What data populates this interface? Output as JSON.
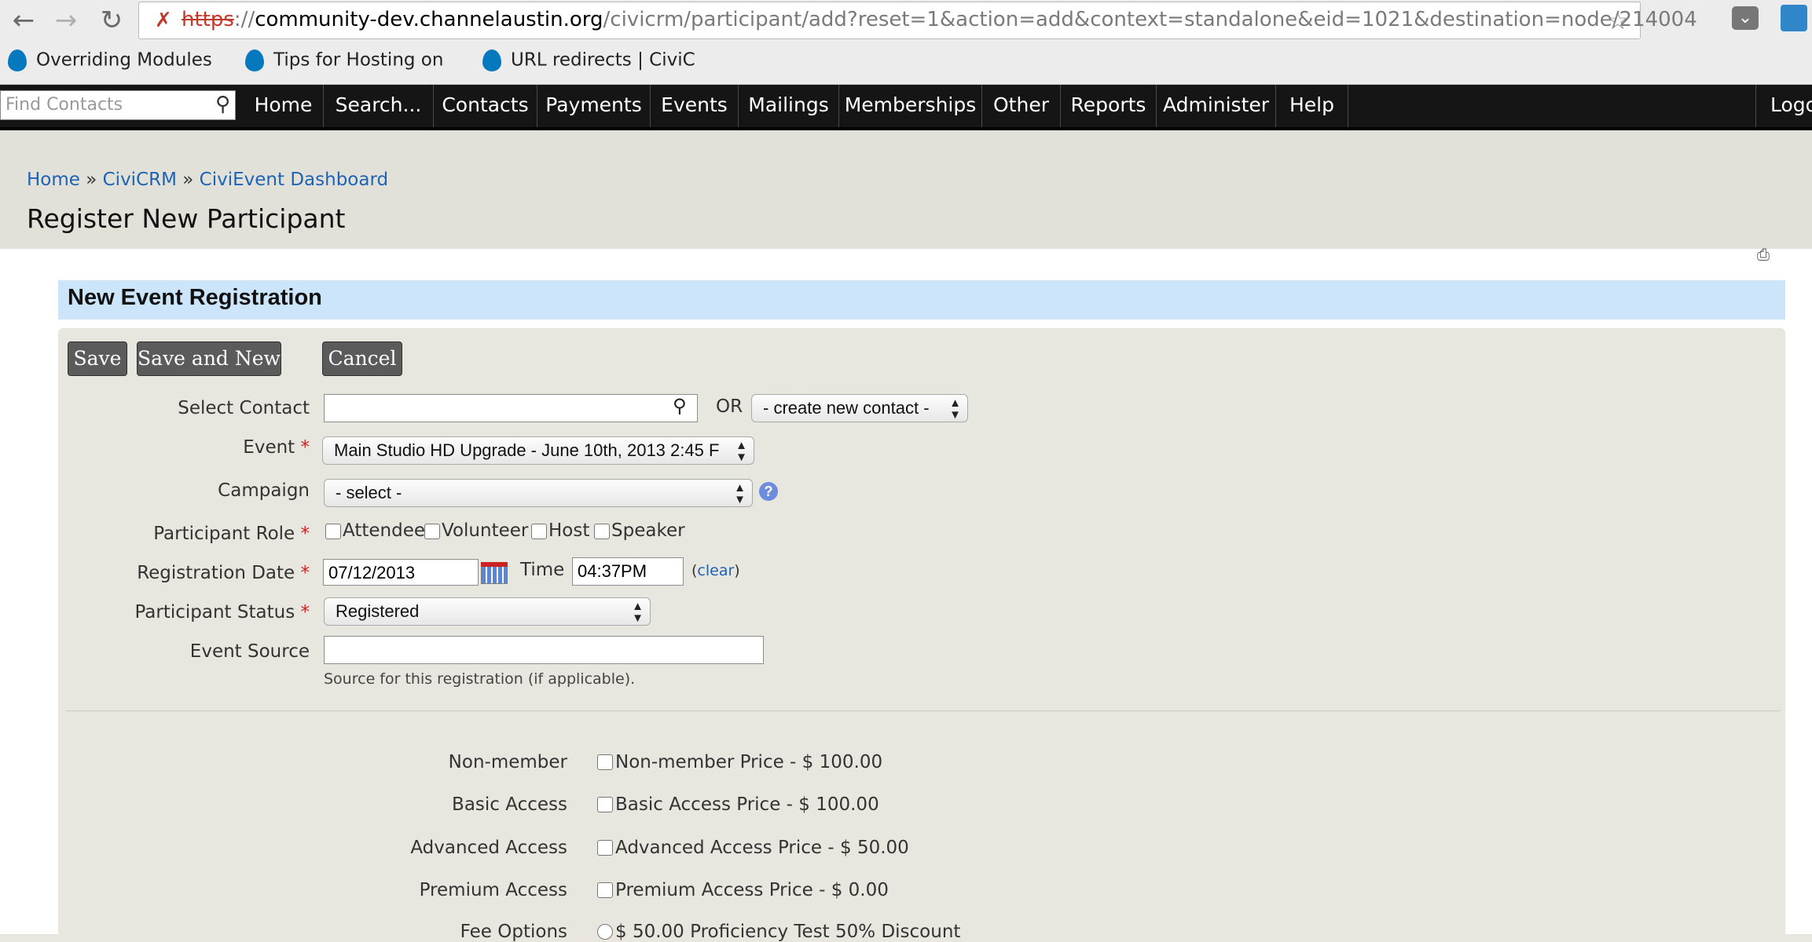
{
  "browser": {
    "url_scheme": "https",
    "url_separator": "://",
    "url_host": "community-dev.channelaustin.org",
    "url_path": "/civicrm/participant/add?reset=1&action=add&context=standalone&eid=1021&destination=node/214004",
    "bookmarks": [
      "Overriding Modules",
      "Tips for Hosting on",
      "URL redirects | CiviC"
    ]
  },
  "menubar": {
    "search_placeholder": "Find Contacts",
    "items": [
      "Home",
      "Search...",
      "Contacts",
      "Payments",
      "Events",
      "Mailings",
      "Memberships",
      "Other",
      "Reports",
      "Administer",
      "Help"
    ],
    "logout": "Logo"
  },
  "breadcrumb": {
    "items": [
      "Home",
      "CiviCRM",
      "CiviEvent Dashboard"
    ],
    "separator": "»"
  },
  "page_title": "Register New Participant",
  "section_title": "New Event Registration",
  "buttons": {
    "save": "Save",
    "save_and_new": "Save and New",
    "cancel": "Cancel"
  },
  "form": {
    "select_contact": {
      "label": "Select Contact",
      "value": "",
      "or_text": "OR",
      "create_new": "- create new contact -"
    },
    "event": {
      "label": "Event",
      "required": "*",
      "value": "Main Studio HD Upgrade - June 10th, 2013 2:45 F"
    },
    "campaign": {
      "label": "Campaign",
      "value": "- select -",
      "help": "?"
    },
    "participant_role": {
      "label": "Participant Role",
      "required": "*",
      "options": [
        "Attendee",
        "Volunteer",
        "Host",
        "Speaker"
      ]
    },
    "registration_date": {
      "label": "Registration Date",
      "required": "*",
      "date": "07/12/2013",
      "time_label": "Time",
      "time": "04:37PM",
      "clear_open": "(",
      "clear": "clear",
      "clear_close": ")"
    },
    "participant_status": {
      "label": "Participant Status",
      "required": "*",
      "value": "Registered"
    },
    "event_source": {
      "label": "Event Source",
      "value": "",
      "help": "Source for this registration (if applicable)."
    }
  },
  "fees": [
    {
      "label": "Non-member",
      "option": "Non-member Price - $ 100.00"
    },
    {
      "label": "Basic Access",
      "option": "Basic Access Price - $ 100.00"
    },
    {
      "label": "Advanced Access",
      "option": "Advanced Access Price - $ 50.00"
    },
    {
      "label": "Premium Access",
      "option": "Premium Access Price - $ 0.00"
    }
  ],
  "fee_options": {
    "label": "Fee Options",
    "option": "$ 50.00 Proficiency Test 50% Discount"
  },
  "colors": {
    "menubar": "#151515",
    "section_header": "#cce5fb",
    "link": "#1d63b5",
    "button": "#5b5b5b",
    "required": "#cc2222"
  },
  "icons": {
    "back": "back-arrow-icon",
    "forward": "forward-arrow-icon",
    "reload": "reload-icon",
    "star": "star-icon",
    "search": "search-icon",
    "print": "print-icon",
    "calendar": "calendar-icon",
    "help": "help-icon"
  }
}
